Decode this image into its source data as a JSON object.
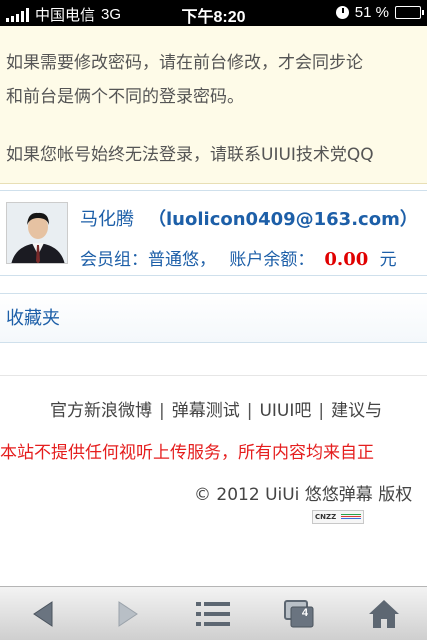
{
  "status_bar": {
    "carrier": "中国电信",
    "network": "3G",
    "time": "下午8:20",
    "battery_text": "51 %",
    "battery_level": 0.51
  },
  "notice": {
    "line1": "如果需要修改密码，请在前台修改，才会同步论",
    "line2": "和前台是俩个不同的登录密码。",
    "line3": "如果您帐号始终无法登录，请联系UIUI技术党QQ"
  },
  "user": {
    "name": "马化腾",
    "email": "（luolicon0409@163.com）",
    "group_label": "会员组：普通悠，",
    "balance_label": "账户余额：",
    "balance_value": "0.00",
    "balance_unit": "元"
  },
  "favorites": {
    "label": "收藏夹"
  },
  "footer": {
    "links": [
      "官方新浪微博",
      "弹幕测试",
      "UIUI吧",
      "建议与"
    ],
    "separator": "|",
    "disclaimer": "本站不提供任何视听上传服务，所有内容均来自正",
    "copyright": "© 2012 UiUi 悠悠弹幕 版权",
    "cnzz_badge": "CNZZ"
  },
  "toolbar": {
    "icons": [
      "back-icon",
      "forward-icon",
      "bookmarks-icon",
      "tabs-icon",
      "home-icon"
    ],
    "tab_count": "4"
  },
  "colors": {
    "link_blue": "#1d5fa8",
    "money_red": "#e00000",
    "notice_bg": "#fefbe8"
  }
}
